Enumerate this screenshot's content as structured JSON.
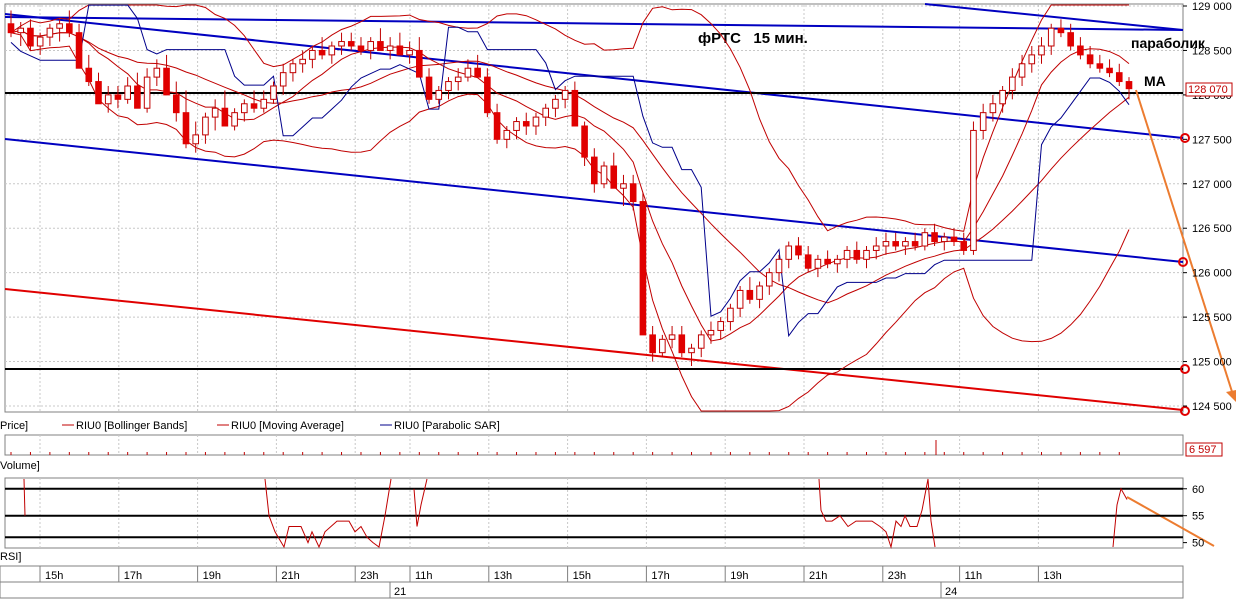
{
  "chart_data": {
    "type": "candlestick",
    "title": "фРТС   15 мин.",
    "annotations": {
      "parabolic": "параболик",
      "ma": "МА"
    },
    "price_axis": {
      "ylim": [
        124400,
        129000
      ],
      "ticks": [
        "129 000",
        "128 500",
        "128 000",
        "127 500",
        "127 000",
        "126 500",
        "126 000",
        "125 500",
        "125 000",
        "124 500"
      ],
      "tick_values": [
        129000,
        128500,
        128000,
        127500,
        127000,
        126500,
        126000,
        125500,
        125000,
        124500
      ],
      "last_price_label": "128 070",
      "last_price": 128070
    },
    "legend": {
      "price": "Price]",
      "items": [
        {
          "name": "RIU0 [Bollinger Bands]",
          "color": "#c00000"
        },
        {
          "name": "RIU0 [Moving Average]",
          "color": "#c00000"
        },
        {
          "name": "RIU0 [Parabolic SAR]",
          "color": "#00008b"
        }
      ]
    },
    "volume": {
      "label": "Volume]",
      "last_value_label": "6 597"
    },
    "rsi": {
      "label": "RSI]",
      "ylim": [
        49,
        62
      ],
      "levels": [
        60,
        55,
        51
      ],
      "ticks": [
        "60",
        "55",
        "50"
      ],
      "tick_values": [
        60,
        55,
        50
      ],
      "segments": [
        [
          [
            24,
            65
          ],
          [
            25,
            55
          ]
        ],
        [
          [
            265,
            65
          ],
          [
            269,
            55
          ],
          [
            275,
            52
          ],
          [
            284,
            48
          ],
          [
            289,
            53
          ],
          [
            301,
            53
          ],
          [
            308,
            50
          ],
          [
            312,
            52
          ],
          [
            319,
            48
          ],
          [
            325,
            52
          ],
          [
            337,
            54
          ],
          [
            349,
            54
          ],
          [
            355,
            52
          ],
          [
            361,
            53
          ],
          [
            367,
            51
          ],
          [
            373,
            50
          ],
          [
            379,
            49
          ],
          [
            385,
            55
          ],
          [
            391,
            70
          ]
        ],
        [
          [
            414,
            60
          ],
          [
            417,
            53
          ],
          [
            421,
            57
          ],
          [
            427,
            64
          ]
        ],
        [
          [
            819,
            64
          ],
          [
            821,
            56
          ],
          [
            826,
            54
          ],
          [
            832,
            54
          ],
          [
            840,
            55
          ],
          [
            848,
            53
          ],
          [
            856,
            54
          ],
          [
            864,
            54
          ],
          [
            872,
            54
          ],
          [
            880,
            53
          ],
          [
            886,
            52
          ],
          [
            891,
            46
          ],
          [
            896,
            54
          ],
          [
            901,
            53
          ],
          [
            905,
            55
          ],
          [
            910,
            53
          ],
          [
            917,
            53
          ],
          [
            922,
            56
          ],
          [
            928,
            67
          ],
          [
            931,
            54
          ],
          [
            935,
            40
          ]
        ],
        [
          [
            1113,
            46
          ],
          [
            1117,
            57
          ],
          [
            1121,
            60
          ],
          [
            1127,
            58
          ]
        ]
      ]
    },
    "time_axis": {
      "labels": [
        "15h",
        "17h",
        "19h",
        "21h",
        "23h",
        "11h",
        "13h",
        "15h",
        "17h",
        "19h",
        "21h",
        "23h",
        "11h",
        "13h"
      ],
      "days": [
        "21",
        "24"
      ]
    },
    "candles_ohlc": [
      [
        128800,
        128950,
        128650,
        128700
      ],
      [
        128700,
        128820,
        128550,
        128750
      ],
      [
        128750,
        128850,
        128500,
        128550
      ],
      [
        128550,
        128700,
        128450,
        128650
      ],
      [
        128650,
        128800,
        128550,
        128750
      ],
      [
        128750,
        128850,
        128600,
        128800
      ],
      [
        128800,
        128950,
        128650,
        128700
      ],
      [
        128700,
        128800,
        128450,
        128300
      ],
      [
        128300,
        128450,
        128100,
        128150
      ],
      [
        128150,
        128250,
        127950,
        127900
      ],
      [
        127900,
        128100,
        127800,
        128000
      ],
      [
        128000,
        128100,
        127850,
        127950
      ],
      [
        127950,
        128200,
        127900,
        128100
      ],
      [
        128100,
        128250,
        127950,
        127850
      ],
      [
        127850,
        128300,
        127800,
        128200
      ],
      [
        128200,
        128400,
        128100,
        128300
      ],
      [
        128300,
        128450,
        128100,
        128000
      ],
      [
        128000,
        128150,
        127700,
        127800
      ],
      [
        127800,
        128050,
        127400,
        127450
      ],
      [
        127450,
        127700,
        127350,
        127550
      ],
      [
        127550,
        127800,
        127450,
        127750
      ],
      [
        127750,
        127950,
        127600,
        127850
      ],
      [
        127850,
        128050,
        127750,
        127650
      ],
      [
        127650,
        127850,
        127600,
        127800
      ],
      [
        127800,
        127950,
        127700,
        127900
      ],
      [
        127900,
        128050,
        127800,
        127850
      ],
      [
        127850,
        128050,
        127800,
        127950
      ],
      [
        127950,
        128150,
        127900,
        128100
      ],
      [
        128100,
        128350,
        128000,
        128250
      ],
      [
        128250,
        128400,
        128150,
        128350
      ],
      [
        128350,
        128500,
        128250,
        128400
      ],
      [
        128400,
        128550,
        128300,
        128500
      ],
      [
        128500,
        128650,
        128400,
        128450
      ],
      [
        128450,
        128600,
        128350,
        128550
      ],
      [
        128550,
        128700,
        128450,
        128600
      ],
      [
        128600,
        128700,
        128500,
        128550
      ],
      [
        128550,
        128650,
        128450,
        128500
      ],
      [
        128500,
        128650,
        128400,
        128600
      ],
      [
        128600,
        128750,
        128500,
        128500
      ],
      [
        128500,
        128650,
        128400,
        128550
      ],
      [
        128550,
        128700,
        128450,
        128450
      ],
      [
        128450,
        128600,
        128350,
        128500
      ],
      [
        128500,
        128650,
        128300,
        128200
      ],
      [
        128200,
        128300,
        127900,
        127950
      ],
      [
        127950,
        128100,
        127900,
        128050
      ],
      [
        128050,
        128200,
        127950,
        128150
      ],
      [
        128150,
        128300,
        128050,
        128200
      ],
      [
        128200,
        128400,
        128150,
        128300
      ],
      [
        128300,
        128450,
        128200,
        128200
      ],
      [
        128200,
        128300,
        127750,
        127800
      ],
      [
        127800,
        127900,
        127450,
        127500
      ],
      [
        127500,
        127650,
        127400,
        127600
      ],
      [
        127600,
        127750,
        127500,
        127700
      ],
      [
        127700,
        127800,
        127550,
        127650
      ],
      [
        127650,
        127800,
        127550,
        127750
      ],
      [
        127750,
        127900,
        127650,
        127850
      ],
      [
        127850,
        128000,
        127750,
        127950
      ],
      [
        127950,
        128100,
        127850,
        128050
      ],
      [
        128050,
        128150,
        127900,
        127650
      ],
      [
        127650,
        127700,
        127200,
        127300
      ],
      [
        127300,
        127400,
        126900,
        127000
      ],
      [
        127000,
        127250,
        126950,
        127200
      ],
      [
        127200,
        127350,
        127000,
        126950
      ],
      [
        126950,
        127100,
        126750,
        127000
      ],
      [
        127000,
        127100,
        126700,
        126800
      ],
      [
        126800,
        126900,
        125300,
        125300
      ],
      [
        125300,
        125400,
        125000,
        125100
      ],
      [
        125100,
        125300,
        125050,
        125250
      ],
      [
        125250,
        125400,
        125150,
        125300
      ],
      [
        125300,
        125400,
        125050,
        125100
      ],
      [
        125100,
        125200,
        124950,
        125150
      ],
      [
        125150,
        125350,
        125050,
        125300
      ],
      [
        125300,
        125450,
        125200,
        125350
      ],
      [
        125350,
        125500,
        125250,
        125450
      ],
      [
        125450,
        125650,
        125350,
        125600
      ],
      [
        125600,
        125850,
        125500,
        125800
      ],
      [
        125800,
        125950,
        125650,
        125700
      ],
      [
        125700,
        125900,
        125600,
        125850
      ],
      [
        125850,
        126050,
        125750,
        126000
      ],
      [
        126000,
        126200,
        125900,
        126150
      ],
      [
        126150,
        126350,
        126050,
        126300
      ],
      [
        126300,
        126400,
        126150,
        126200
      ],
      [
        126200,
        126300,
        126000,
        126050
      ],
      [
        126050,
        126200,
        125950,
        126150
      ],
      [
        126150,
        126250,
        126050,
        126100
      ],
      [
        126100,
        126200,
        126000,
        126150
      ],
      [
        126150,
        126300,
        126050,
        126250
      ],
      [
        126250,
        126350,
        126100,
        126150
      ],
      [
        126150,
        126300,
        126050,
        126250
      ],
      [
        126250,
        126400,
        126150,
        126300
      ],
      [
        126300,
        126450,
        126200,
        126350
      ],
      [
        126350,
        126450,
        126250,
        126300
      ],
      [
        126300,
        126400,
        126200,
        126350
      ],
      [
        126350,
        126450,
        126250,
        126300
      ],
      [
        126300,
        126500,
        126250,
        126450
      ],
      [
        126450,
        126550,
        126300,
        126350
      ],
      [
        126350,
        126450,
        126250,
        126400
      ],
      [
        126400,
        126500,
        126300,
        126350
      ],
      [
        126350,
        126450,
        126200,
        126250
      ],
      [
        126250,
        127700,
        126200,
        127600
      ],
      [
        127600,
        127900,
        127500,
        127800
      ],
      [
        127800,
        128000,
        127700,
        127900
      ],
      [
        127900,
        128100,
        127800,
        128050
      ],
      [
        128050,
        128300,
        127950,
        128200
      ],
      [
        128200,
        128450,
        128100,
        128350
      ],
      [
        128350,
        128550,
        128250,
        128450
      ],
      [
        128450,
        128650,
        128350,
        128550
      ],
      [
        128550,
        128800,
        128450,
        128750
      ],
      [
        128750,
        128850,
        128650,
        128700
      ],
      [
        128700,
        128800,
        128500,
        128550
      ],
      [
        128550,
        128650,
        128400,
        128450
      ],
      [
        128450,
        128550,
        128300,
        128350
      ],
      [
        128350,
        128450,
        128250,
        128300
      ],
      [
        128300,
        128400,
        128200,
        128250
      ],
      [
        128250,
        128350,
        128100,
        128150
      ],
      [
        128150,
        128200,
        127950,
        128070
      ]
    ]
  }
}
